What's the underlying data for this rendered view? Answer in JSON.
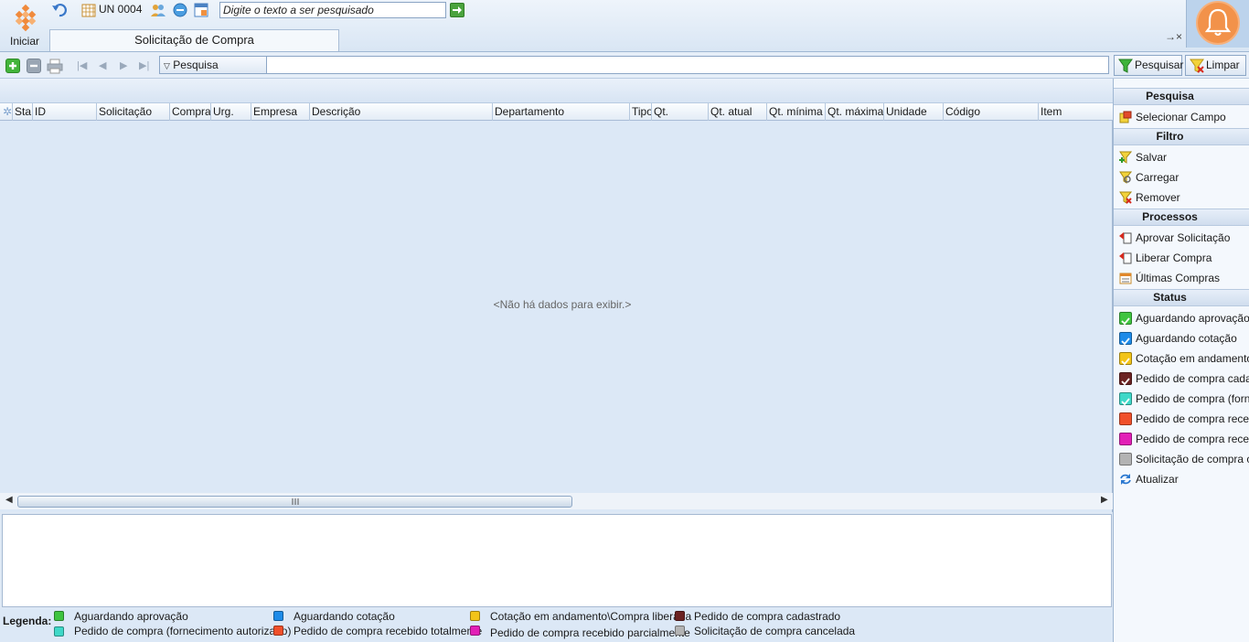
{
  "topbar": {
    "start_label": "Iniciar",
    "unit_label": "UN 0004",
    "search_placeholder": "Digite o texto a ser pesquisado",
    "tab_title": "Solicitação de Compra",
    "tab_close": "→×"
  },
  "toolbar": {
    "search_combo_label": "Pesquisa",
    "search_button": "Pesquisar",
    "clear_button": "Limpar"
  },
  "grid": {
    "columns": [
      "Sta",
      "ID",
      "Solicitação",
      "Compra",
      "Urg.",
      "Empresa",
      "Descrição",
      "Departamento",
      "Tipo",
      "Qt.",
      "Qt. atual",
      "Qt. mínima",
      "Qt. máxima",
      "Unidade",
      "Código",
      "Item"
    ],
    "empty_message": "<Não há dados para exibir.>"
  },
  "legend": {
    "title": "Legenda:",
    "items": [
      {
        "label": "Aguardando aprovação",
        "color": "#3fc43f"
      },
      {
        "label": "Pedido de compra (fornecimento autorizado)",
        "color": "#3fd8c8"
      },
      {
        "label": "Aguardando cotação",
        "color": "#1e8be8"
      },
      {
        "label": "Pedido de compra recebido totalmente",
        "color": "#f0502a"
      },
      {
        "label": "Cotação em andamento\\Compra liberada",
        "color": "#f2c418"
      },
      {
        "label": "Pedido de compra recebido parcialmente",
        "color": "#e21fb7"
      },
      {
        "label": "Pedido de compra cadastrado",
        "color": "#6b2222"
      },
      {
        "label": "Solicitação de compra cancelada",
        "color": "#b3b3b3"
      }
    ]
  },
  "side": {
    "sections": {
      "pesquisa": "Pesquisa",
      "filtro": "Filtro",
      "processos": "Processos",
      "status": "Status"
    },
    "pesquisa_items": [
      "Selecionar Campo"
    ],
    "filtro_items": [
      "Salvar",
      "Carregar",
      "Remover"
    ],
    "processos_items": [
      "Aprovar Solicitação",
      "Liberar Compra",
      "Últimas Compras"
    ],
    "status_items": [
      {
        "label": "Aguardando aprovação",
        "color": "#3fc43f"
      },
      {
        "label": "Aguardando cotação",
        "color": "#1e8be8"
      },
      {
        "label": "Cotação em andamento\\Compra liberada",
        "color": "#f2c418"
      },
      {
        "label": "Pedido de compra cadastrado",
        "color": "#6b2222"
      },
      {
        "label": "Pedido de compra (fornecimento autorizado)",
        "color": "#3fd8c8"
      },
      {
        "label": "Pedido de compra recebido totalmente",
        "color": "#f0502a"
      },
      {
        "label": "Pedido de compra recebido parcialmente",
        "color": "#e21fb7"
      },
      {
        "label": "Solicitação de compra cancelada",
        "color": "#b3b3b3"
      }
    ],
    "refresh_label": "Atualizar"
  }
}
